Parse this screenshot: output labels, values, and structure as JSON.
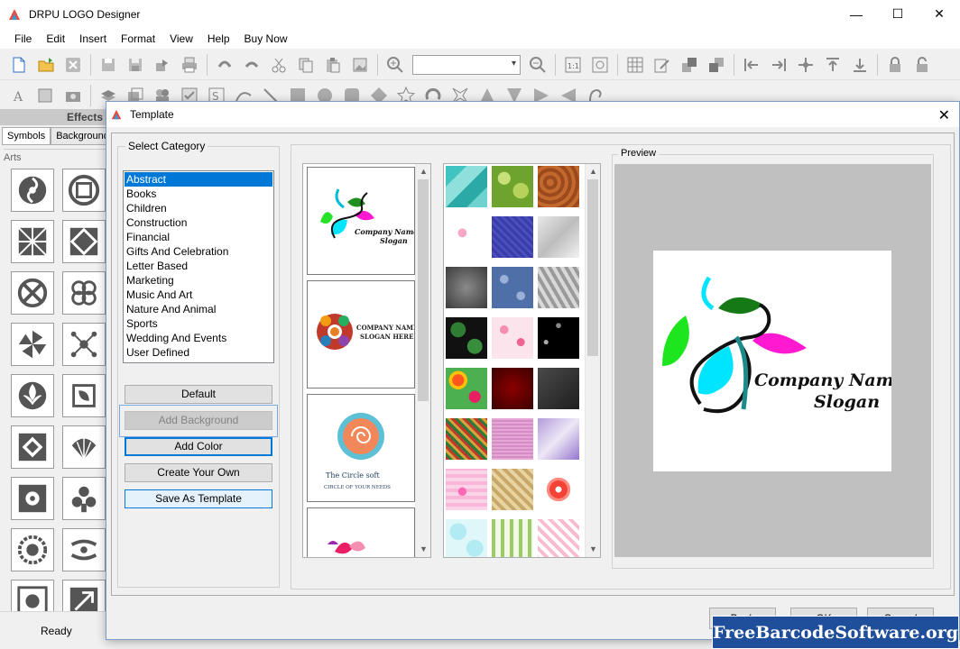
{
  "window": {
    "title": "DRPU LOGO Designer",
    "minimize": "—",
    "maximize": "☐",
    "close": "✕"
  },
  "menu": [
    "File",
    "Edit",
    "Insert",
    "Format",
    "View",
    "Help",
    "Buy Now"
  ],
  "left_panel": {
    "title": "Effects",
    "tabs": [
      "Symbols",
      "Backgrounds"
    ],
    "section_label": "Arts"
  },
  "status": {
    "text": "Ready"
  },
  "dialog": {
    "title": "Template",
    "close": "✕",
    "category_label": "Select Category",
    "categories": [
      "Abstract",
      "Books",
      "Children",
      "Construction",
      "Financial",
      "Gifts And Celebration",
      "Letter Based",
      "Marketing",
      "Music And Art",
      "Nature And Animal",
      "Sports",
      "Wedding And Events",
      "User Defined"
    ],
    "selected_category": "Abstract",
    "buttons": {
      "default": "Default",
      "add_background": "Add Background",
      "add_color": "Add Color",
      "create_your_own": "Create Your Own",
      "save_as_template": "Save As Template"
    },
    "templates": [
      {
        "line1": "Company Name",
        "line2": "Slogan"
      },
      {
        "line1": "COMPANY NAME",
        "line2": "SLOGAN HERE"
      },
      {
        "line1": "The Circle soft",
        "line2": "CIRCLE OF YOUR NEEDS"
      }
    ],
    "preview_label": "Preview",
    "preview": {
      "line1": "Company Name",
      "line2": "Slogan"
    },
    "footer": {
      "back": "Back",
      "ok": "OK",
      "cancel": "Cancel"
    }
  },
  "watermark": "FreeBarcodeSoftware.org",
  "colors": {
    "accent": "#0078d7",
    "watermark_bg": "#1f4e9a"
  }
}
